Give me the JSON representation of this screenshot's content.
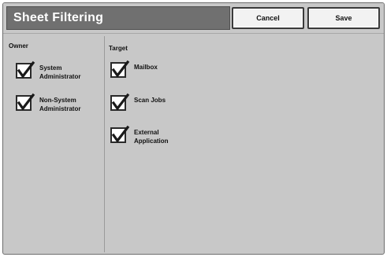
{
  "header": {
    "title": "Sheet Filtering",
    "cancel_label": "Cancel",
    "save_label": "Save"
  },
  "owner": {
    "heading": "Owner",
    "items": [
      {
        "line1": "System",
        "line2": "Administrator",
        "checked": true
      },
      {
        "line1": "Non-System",
        "line2": "Administrator",
        "checked": true
      }
    ]
  },
  "target": {
    "heading": "Target",
    "items": [
      {
        "line1": "Mailbox",
        "line2": "",
        "checked": true
      },
      {
        "line1": "Scan Jobs",
        "line2": "",
        "checked": true
      },
      {
        "line1": "External",
        "line2": "Application",
        "checked": true
      }
    ]
  },
  "icons": {
    "checkmark": "checkmark-icon"
  }
}
